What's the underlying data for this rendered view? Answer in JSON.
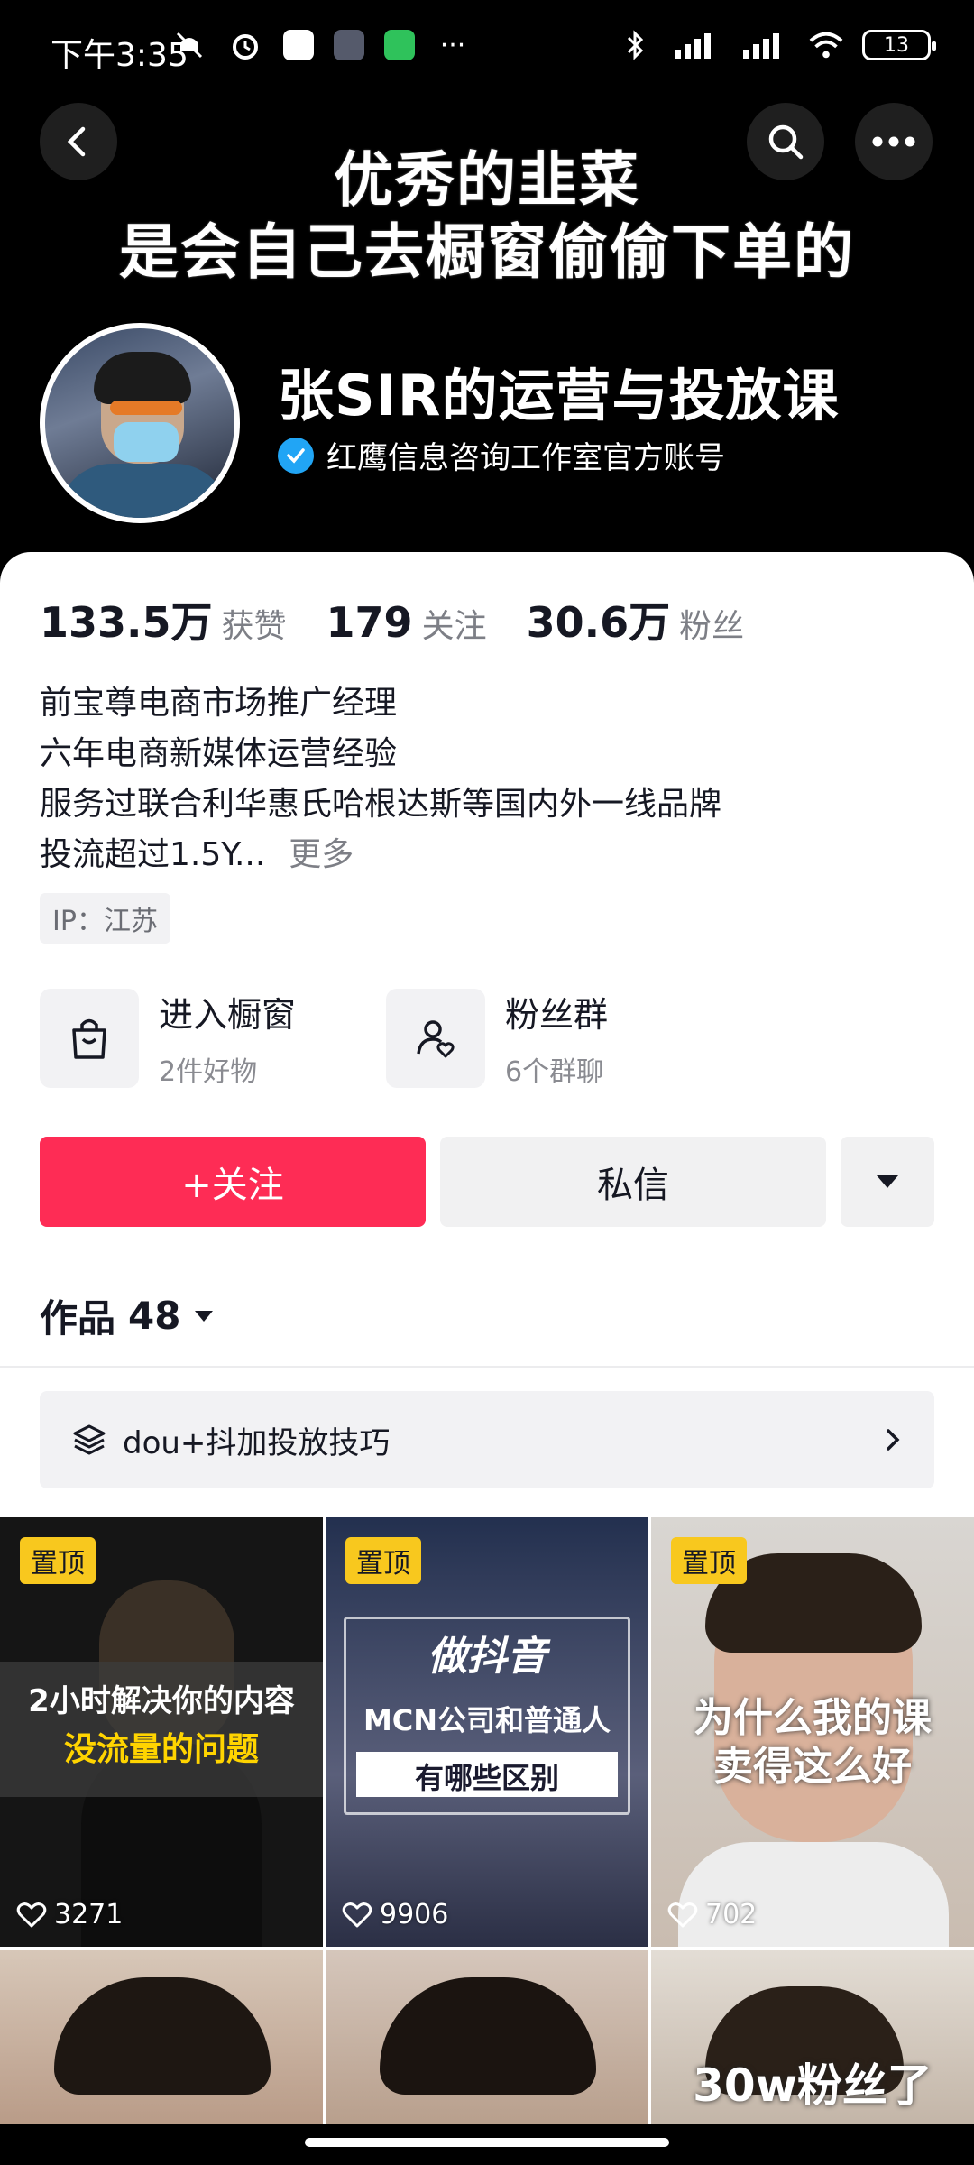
{
  "status_bar": {
    "time": "下午3:35",
    "battery": "13"
  },
  "header": {
    "slogan_line1": "优秀的韭菜",
    "slogan_line2": "是会自己去橱窗偷偷下单的",
    "name": "张SIR的运营与投放课",
    "verified_label": "红鹰信息咨询工作室官方账号"
  },
  "stats": [
    {
      "value": "133.5万",
      "label": "获赞"
    },
    {
      "value": "179",
      "label": "关注"
    },
    {
      "value": "30.6万",
      "label": "粉丝"
    }
  ],
  "bio": {
    "lines": [
      "前宝尊电商市场推广经理",
      "六年电商新媒体运营经验",
      "服务过联合利华惠氏哈根达斯等国内外一线品牌"
    ],
    "last_line": "投流超过1.5Y...",
    "more": "更多",
    "ip": "IP：江苏"
  },
  "features": [
    {
      "title": "进入橱窗",
      "sub": "2件好物"
    },
    {
      "title": "粉丝群",
      "sub": "6个群聊"
    }
  ],
  "buttons": {
    "follow": "+关注",
    "message": "私信"
  },
  "works": {
    "label": "作品",
    "count": "48"
  },
  "collection": {
    "label": "dou+抖加投放技巧"
  },
  "videos": [
    {
      "pinned": "置顶",
      "likes": "3271",
      "caption1": "2小时解决你的内容",
      "caption2": "没流量的问题"
    },
    {
      "pinned": "置顶",
      "likes": "9906",
      "caption1": "做抖音",
      "caption2": "MCN公司和普通人",
      "caption3": "有哪些区别"
    },
    {
      "pinned": "置顶",
      "likes": "702",
      "caption1": "为什么我的课",
      "caption2": "卖得这么好"
    },
    {
      "caption1": ""
    },
    {
      "caption1": ""
    },
    {
      "caption1": "30w粉丝了"
    }
  ],
  "colors": {
    "accent": "#fe2c55",
    "pin": "#f8c81e",
    "verified": "#21a5f5"
  }
}
